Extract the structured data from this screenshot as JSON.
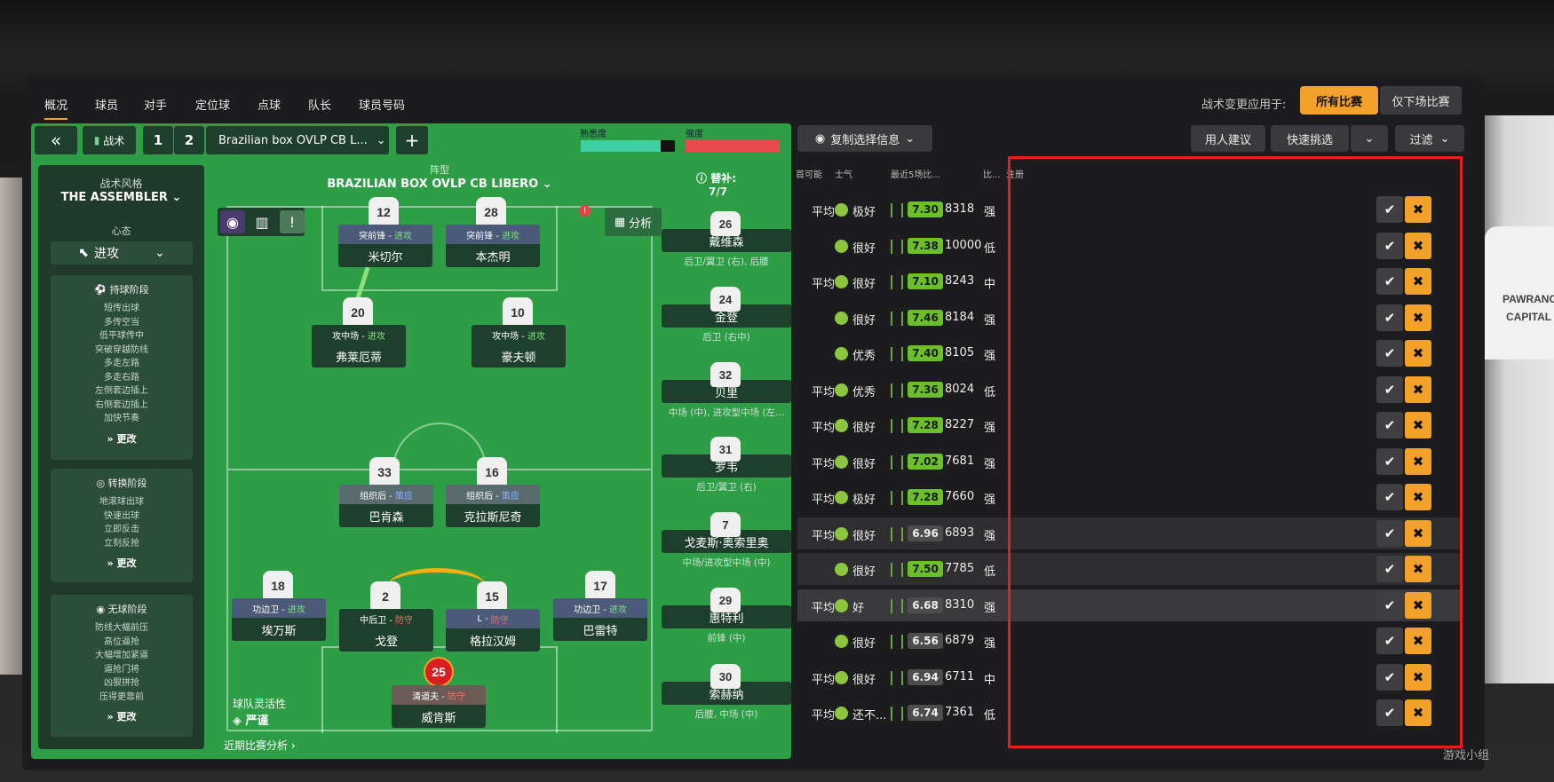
{
  "tabs": [
    "概况",
    "球员",
    "对手",
    "定位球",
    "点球",
    "队长",
    "球员号码"
  ],
  "active_tab": 0,
  "apply_label": "战术变更应用于:",
  "apply_all": "所有比赛",
  "apply_next": "仅下场比赛",
  "toolbar": {
    "tactic_label": "战术",
    "slot1": "1",
    "slot2": "2",
    "tactic_name": "Brazilian box OVLP CB L...",
    "add": "+",
    "familiarity": "熟悉度",
    "intensity": "强度"
  },
  "style": {
    "label": "战术风格",
    "value": "THE ASSEMBLER",
    "mentality_label": "心态",
    "mentality_value": "进攻"
  },
  "phases": [
    {
      "title": "持球阶段",
      "items": [
        "短传出球",
        "多传空当",
        "低平球传中",
        "突破穿越防线",
        "多走左路",
        "多走右路",
        "左侧套边插上",
        "右侧套边插上",
        "加快节奏"
      ],
      "more": "更改"
    },
    {
      "title": "转换阶段",
      "items": [
        "地滚球出球",
        "快速出球",
        "立即反击",
        "立刻反抢"
      ],
      "more": "更改"
    },
    {
      "title": "无球阶段",
      "items": [
        "防线大幅前压",
        "高位逼抢",
        "大幅增加紧逼",
        "逼抢门将",
        "凶狠拼抢",
        "压得更靠前"
      ],
      "more": "更改"
    }
  ],
  "formation": {
    "label": "阵型",
    "value": "BRAZILIAN BOX OVLP CB LIBERO",
    "analysis": "分析",
    "flex_label": "球队灵活性",
    "flex_value": "严谨",
    "recent": "近期比赛分析"
  },
  "players": [
    {
      "num": "12",
      "role": "突前锋 - ",
      "duty": "进攻",
      "name": "米切尔"
    },
    {
      "num": "28",
      "role": "突前锋 - ",
      "duty": "进攻",
      "name": "本杰明"
    },
    {
      "num": "20",
      "role": "攻中场 - ",
      "duty": "进攻",
      "name": "弗莱厄蒂"
    },
    {
      "num": "10",
      "role": "攻中场 - ",
      "duty": "进攻",
      "name": "豪夫顿"
    },
    {
      "num": "33",
      "role": "组织后 - ",
      "duty": "策应",
      "name": "巴肯森"
    },
    {
      "num": "16",
      "role": "组织后 - ",
      "duty": "策应",
      "name": "克拉斯尼奇"
    },
    {
      "num": "18",
      "role": "功边卫 - ",
      "duty": "进攻",
      "name": "埃万斯"
    },
    {
      "num": "2",
      "role": "中后卫 - ",
      "duty": "防守",
      "name": "戈登"
    },
    {
      "num": "15",
      "role": "L - ",
      "duty": "防守",
      "name": "格拉汉姆"
    },
    {
      "num": "17",
      "role": "功边卫 - ",
      "duty": "进攻",
      "name": "巴雷特"
    },
    {
      "num": "25",
      "role": "清道夫 - ",
      "duty": "防守",
      "name": "威肯斯"
    }
  ],
  "subs": {
    "label": "替补:",
    "count": "7/7",
    "list": [
      {
        "num": "26",
        "name": "戴维森",
        "pos": "后卫/翼卫 (右), 后腰"
      },
      {
        "num": "24",
        "name": "金登",
        "pos": "后卫 (右中)"
      },
      {
        "num": "32",
        "name": "贝里",
        "pos": "中场 (中), 进攻型中场 (左..."
      },
      {
        "num": "31",
        "name": "罗韦",
        "pos": "后卫/翼卫 (右)"
      },
      {
        "num": "7",
        "name": "戈麦斯·奥索里奥",
        "pos": "中场/进攻型中场 (中)"
      },
      {
        "num": "29",
        "name": "惠特利",
        "pos": "前锋 (中)"
      },
      {
        "num": "30",
        "name": "索赫纳",
        "pos": "后腰, 中场 (中)"
      }
    ]
  },
  "right": {
    "copy": "复制选择信息",
    "advice": "用人建议",
    "quick": "快速挑选",
    "filter": "过滤",
    "headers": [
      "首可能",
      "士气",
      "最近5场比...",
      "比...",
      "注册"
    ]
  },
  "rows": [
    {
      "avail": "平均",
      "morale": "极好",
      "rating": "7.30",
      "val": "8318",
      "level": "强",
      "good": true
    },
    {
      "avail": "",
      "morale": "很好",
      "rating": "7.38",
      "val": "10000",
      "level": "低",
      "good": true
    },
    {
      "avail": "平均",
      "morale": "很好",
      "rating": "7.10",
      "val": "8243",
      "level": "中",
      "good": true
    },
    {
      "avail": "",
      "morale": "很好",
      "rating": "7.46",
      "val": "8184",
      "level": "强",
      "good": true
    },
    {
      "avail": "",
      "morale": "优秀",
      "rating": "7.40",
      "val": "8105",
      "level": "强",
      "good": true
    },
    {
      "avail": "平均",
      "morale": "优秀",
      "rating": "7.36",
      "val": "8024",
      "level": "低",
      "good": true
    },
    {
      "avail": "平均",
      "morale": "很好",
      "rating": "7.28",
      "val": "8227",
      "level": "强",
      "good": true
    },
    {
      "avail": "平均",
      "morale": "很好",
      "rating": "7.02",
      "val": "7681",
      "level": "强",
      "good": true
    },
    {
      "avail": "平均",
      "morale": "极好",
      "rating": "7.28",
      "val": "7660",
      "level": "强",
      "good": true
    },
    {
      "avail": "平均",
      "morale": "很好",
      "rating": "6.96",
      "val": "6893",
      "level": "强",
      "good": false
    },
    {
      "avail": "",
      "morale": "很好",
      "rating": "7.50",
      "val": "7785",
      "level": "低",
      "good": true
    },
    {
      "avail": "平均",
      "morale": "好",
      "rating": "6.68",
      "val": "8310",
      "level": "强",
      "good": false
    },
    {
      "avail": "",
      "morale": "很好",
      "rating": "6.56",
      "val": "6879",
      "level": "强",
      "good": false
    },
    {
      "avail": "平均",
      "morale": "很好",
      "rating": "6.94",
      "val": "6711",
      "level": "中",
      "good": false
    },
    {
      "avail": "平均",
      "morale": "还不...",
      "rating": "6.74",
      "val": "7361",
      "level": "低",
      "good": false
    }
  ],
  "watermark": "游戏小组"
}
